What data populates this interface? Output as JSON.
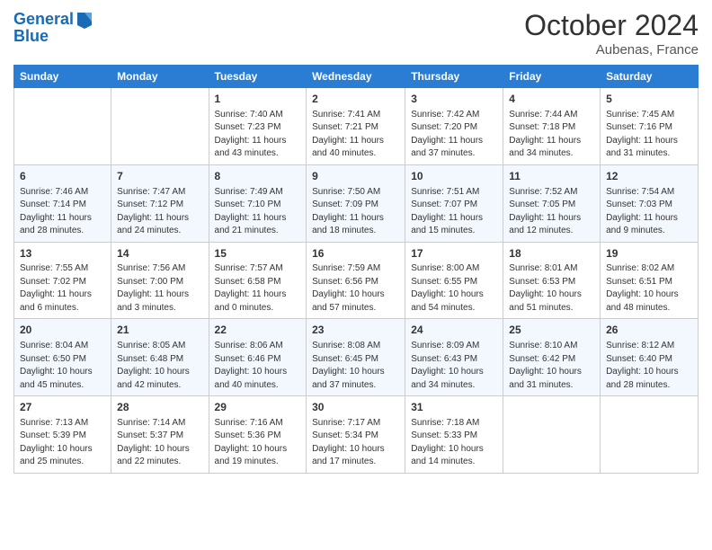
{
  "header": {
    "logo_line1": "General",
    "logo_line2": "Blue",
    "month": "October 2024",
    "location": "Aubenas, France"
  },
  "days_of_week": [
    "Sunday",
    "Monday",
    "Tuesday",
    "Wednesday",
    "Thursday",
    "Friday",
    "Saturday"
  ],
  "weeks": [
    [
      {
        "day": "",
        "sunrise": "",
        "sunset": "",
        "daylight": ""
      },
      {
        "day": "",
        "sunrise": "",
        "sunset": "",
        "daylight": ""
      },
      {
        "day": "1",
        "sunrise": "Sunrise: 7:40 AM",
        "sunset": "Sunset: 7:23 PM",
        "daylight": "Daylight: 11 hours and 43 minutes."
      },
      {
        "day": "2",
        "sunrise": "Sunrise: 7:41 AM",
        "sunset": "Sunset: 7:21 PM",
        "daylight": "Daylight: 11 hours and 40 minutes."
      },
      {
        "day": "3",
        "sunrise": "Sunrise: 7:42 AM",
        "sunset": "Sunset: 7:20 PM",
        "daylight": "Daylight: 11 hours and 37 minutes."
      },
      {
        "day": "4",
        "sunrise": "Sunrise: 7:44 AM",
        "sunset": "Sunset: 7:18 PM",
        "daylight": "Daylight: 11 hours and 34 minutes."
      },
      {
        "day": "5",
        "sunrise": "Sunrise: 7:45 AM",
        "sunset": "Sunset: 7:16 PM",
        "daylight": "Daylight: 11 hours and 31 minutes."
      }
    ],
    [
      {
        "day": "6",
        "sunrise": "Sunrise: 7:46 AM",
        "sunset": "Sunset: 7:14 PM",
        "daylight": "Daylight: 11 hours and 28 minutes."
      },
      {
        "day": "7",
        "sunrise": "Sunrise: 7:47 AM",
        "sunset": "Sunset: 7:12 PM",
        "daylight": "Daylight: 11 hours and 24 minutes."
      },
      {
        "day": "8",
        "sunrise": "Sunrise: 7:49 AM",
        "sunset": "Sunset: 7:10 PM",
        "daylight": "Daylight: 11 hours and 21 minutes."
      },
      {
        "day": "9",
        "sunrise": "Sunrise: 7:50 AM",
        "sunset": "Sunset: 7:09 PM",
        "daylight": "Daylight: 11 hours and 18 minutes."
      },
      {
        "day": "10",
        "sunrise": "Sunrise: 7:51 AM",
        "sunset": "Sunset: 7:07 PM",
        "daylight": "Daylight: 11 hours and 15 minutes."
      },
      {
        "day": "11",
        "sunrise": "Sunrise: 7:52 AM",
        "sunset": "Sunset: 7:05 PM",
        "daylight": "Daylight: 11 hours and 12 minutes."
      },
      {
        "day": "12",
        "sunrise": "Sunrise: 7:54 AM",
        "sunset": "Sunset: 7:03 PM",
        "daylight": "Daylight: 11 hours and 9 minutes."
      }
    ],
    [
      {
        "day": "13",
        "sunrise": "Sunrise: 7:55 AM",
        "sunset": "Sunset: 7:02 PM",
        "daylight": "Daylight: 11 hours and 6 minutes."
      },
      {
        "day": "14",
        "sunrise": "Sunrise: 7:56 AM",
        "sunset": "Sunset: 7:00 PM",
        "daylight": "Daylight: 11 hours and 3 minutes."
      },
      {
        "day": "15",
        "sunrise": "Sunrise: 7:57 AM",
        "sunset": "Sunset: 6:58 PM",
        "daylight": "Daylight: 11 hours and 0 minutes."
      },
      {
        "day": "16",
        "sunrise": "Sunrise: 7:59 AM",
        "sunset": "Sunset: 6:56 PM",
        "daylight": "Daylight: 10 hours and 57 minutes."
      },
      {
        "day": "17",
        "sunrise": "Sunrise: 8:00 AM",
        "sunset": "Sunset: 6:55 PM",
        "daylight": "Daylight: 10 hours and 54 minutes."
      },
      {
        "day": "18",
        "sunrise": "Sunrise: 8:01 AM",
        "sunset": "Sunset: 6:53 PM",
        "daylight": "Daylight: 10 hours and 51 minutes."
      },
      {
        "day": "19",
        "sunrise": "Sunrise: 8:02 AM",
        "sunset": "Sunset: 6:51 PM",
        "daylight": "Daylight: 10 hours and 48 minutes."
      }
    ],
    [
      {
        "day": "20",
        "sunrise": "Sunrise: 8:04 AM",
        "sunset": "Sunset: 6:50 PM",
        "daylight": "Daylight: 10 hours and 45 minutes."
      },
      {
        "day": "21",
        "sunrise": "Sunrise: 8:05 AM",
        "sunset": "Sunset: 6:48 PM",
        "daylight": "Daylight: 10 hours and 42 minutes."
      },
      {
        "day": "22",
        "sunrise": "Sunrise: 8:06 AM",
        "sunset": "Sunset: 6:46 PM",
        "daylight": "Daylight: 10 hours and 40 minutes."
      },
      {
        "day": "23",
        "sunrise": "Sunrise: 8:08 AM",
        "sunset": "Sunset: 6:45 PM",
        "daylight": "Daylight: 10 hours and 37 minutes."
      },
      {
        "day": "24",
        "sunrise": "Sunrise: 8:09 AM",
        "sunset": "Sunset: 6:43 PM",
        "daylight": "Daylight: 10 hours and 34 minutes."
      },
      {
        "day": "25",
        "sunrise": "Sunrise: 8:10 AM",
        "sunset": "Sunset: 6:42 PM",
        "daylight": "Daylight: 10 hours and 31 minutes."
      },
      {
        "day": "26",
        "sunrise": "Sunrise: 8:12 AM",
        "sunset": "Sunset: 6:40 PM",
        "daylight": "Daylight: 10 hours and 28 minutes."
      }
    ],
    [
      {
        "day": "27",
        "sunrise": "Sunrise: 7:13 AM",
        "sunset": "Sunset: 5:39 PM",
        "daylight": "Daylight: 10 hours and 25 minutes."
      },
      {
        "day": "28",
        "sunrise": "Sunrise: 7:14 AM",
        "sunset": "Sunset: 5:37 PM",
        "daylight": "Daylight: 10 hours and 22 minutes."
      },
      {
        "day": "29",
        "sunrise": "Sunrise: 7:16 AM",
        "sunset": "Sunset: 5:36 PM",
        "daylight": "Daylight: 10 hours and 19 minutes."
      },
      {
        "day": "30",
        "sunrise": "Sunrise: 7:17 AM",
        "sunset": "Sunset: 5:34 PM",
        "daylight": "Daylight: 10 hours and 17 minutes."
      },
      {
        "day": "31",
        "sunrise": "Sunrise: 7:18 AM",
        "sunset": "Sunset: 5:33 PM",
        "daylight": "Daylight: 10 hours and 14 minutes."
      },
      {
        "day": "",
        "sunrise": "",
        "sunset": "",
        "daylight": ""
      },
      {
        "day": "",
        "sunrise": "",
        "sunset": "",
        "daylight": ""
      }
    ]
  ]
}
